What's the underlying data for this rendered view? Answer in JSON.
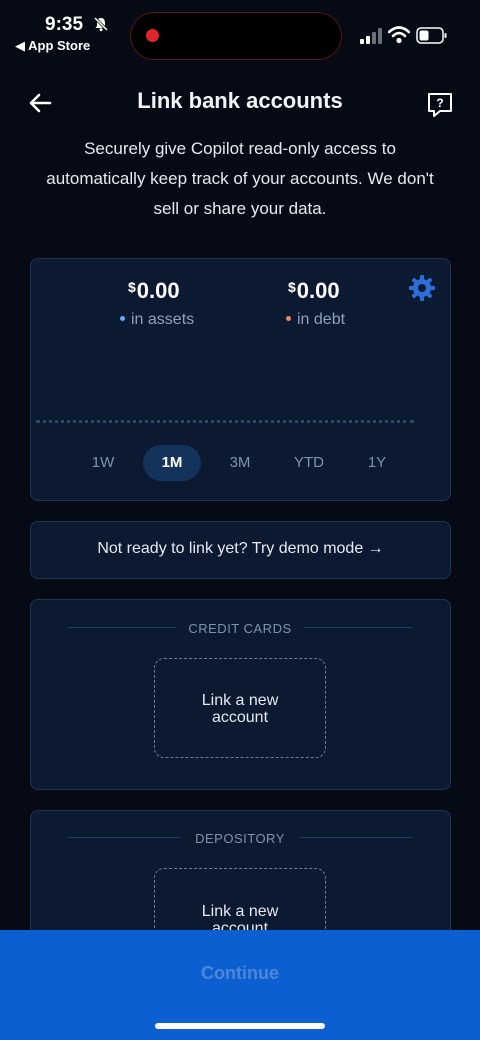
{
  "status_bar": {
    "time": "9:35",
    "back_app": "◀ App Store"
  },
  "header": {
    "title": "Link bank accounts",
    "subtitle": "Securely give Copilot read-only access to automatically keep track of your accounts. We don't sell or share your data."
  },
  "summary": {
    "assets_amount": "0.00",
    "assets_label": "in assets",
    "debt_amount": "0.00",
    "debt_label": "in debt",
    "currency_symbol": "$"
  },
  "ranges": [
    "1W",
    "1M",
    "3M",
    "YTD",
    "1Y"
  ],
  "selected_range": "1M",
  "demo": {
    "text": "Not ready to link yet?  Try demo mode →"
  },
  "sections": [
    {
      "label": "CREDIT CARDS",
      "link_label_1": "Link a new",
      "link_label_2": "account"
    },
    {
      "label": "DEPOSITORY",
      "link_label_1": "Link a new",
      "link_label_2": "account"
    }
  ],
  "continue_label": "Continue",
  "colors": {
    "background": "#050a14",
    "card": "#0b1a31",
    "primary": "#0b5fd1",
    "assets_dot": "#6aa6ff",
    "debt_dot": "#f0875a"
  }
}
